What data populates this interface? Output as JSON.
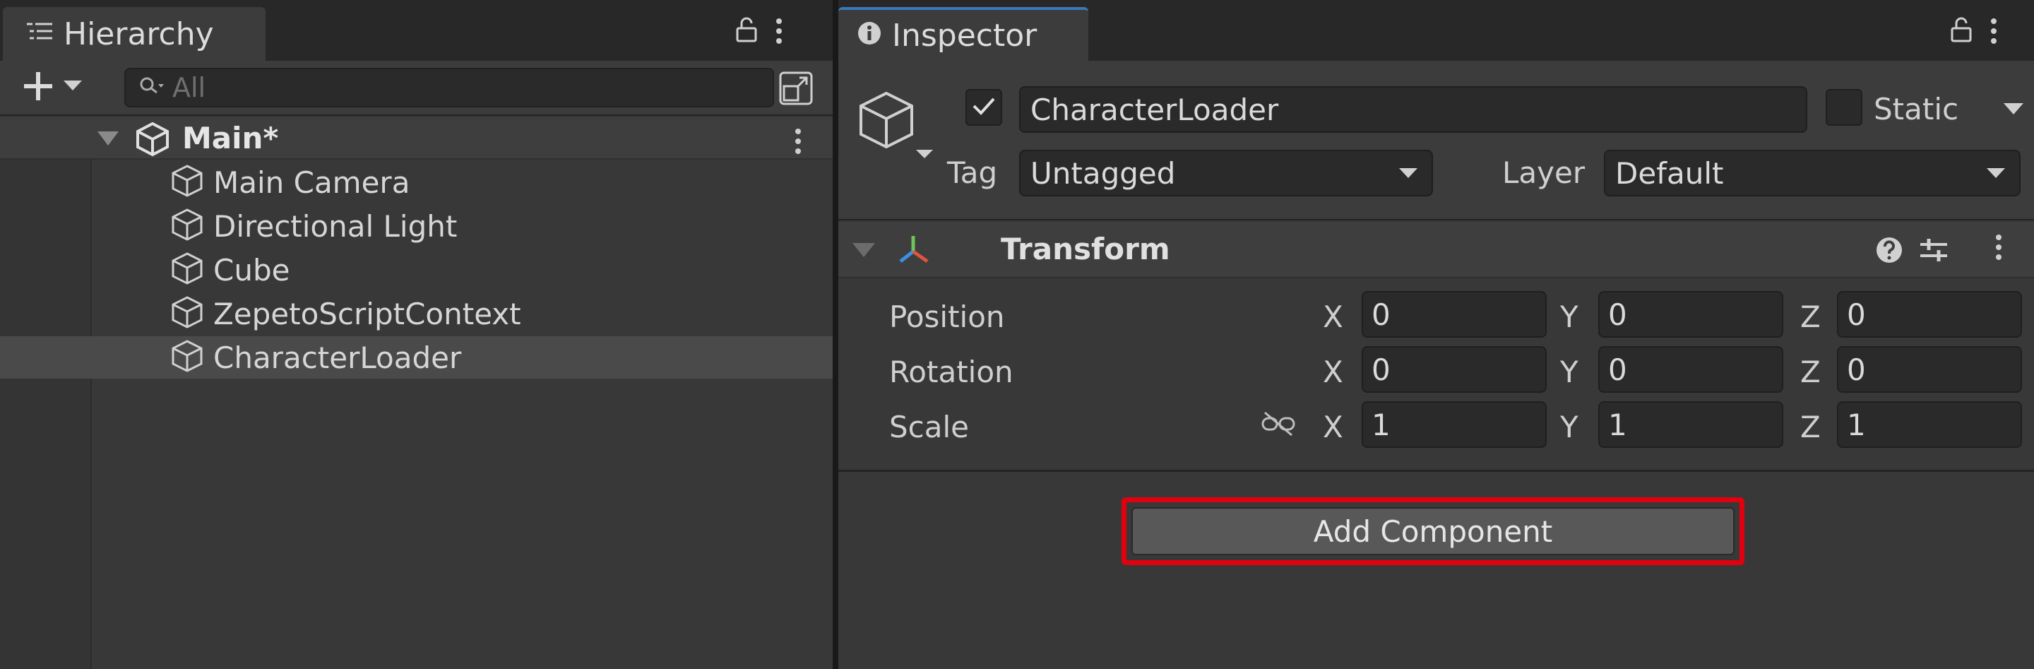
{
  "hierarchy": {
    "tab_label": "Hierarchy",
    "search": {
      "placeholder": "All",
      "value": ""
    },
    "scene": {
      "name": "Main*"
    },
    "items": [
      {
        "label": "Main Camera"
      },
      {
        "label": "Directional Light"
      },
      {
        "label": "Cube"
      },
      {
        "label": "ZepetoScriptContext"
      },
      {
        "label": "CharacterLoader"
      }
    ]
  },
  "inspector": {
    "tab_label": "Inspector",
    "object": {
      "name": "CharacterLoader",
      "active": true,
      "static_label": "Static",
      "tag_label": "Tag",
      "tag_value": "Untagged",
      "layer_label": "Layer",
      "layer_value": "Default"
    },
    "transform": {
      "title": "Transform",
      "rows": [
        {
          "label": "Position",
          "x": "0",
          "y": "0",
          "z": "0"
        },
        {
          "label": "Rotation",
          "x": "0",
          "y": "0",
          "z": "0"
        },
        {
          "label": "Scale",
          "x": "1",
          "y": "1",
          "z": "1"
        }
      ],
      "axis_labels": {
        "x": "X",
        "y": "Y",
        "z": "Z"
      }
    },
    "add_component_label": "Add Component"
  },
  "colors": {
    "highlight": "#e2000f",
    "tab_accent": "#3a79bb",
    "panel_bg": "#383838"
  }
}
